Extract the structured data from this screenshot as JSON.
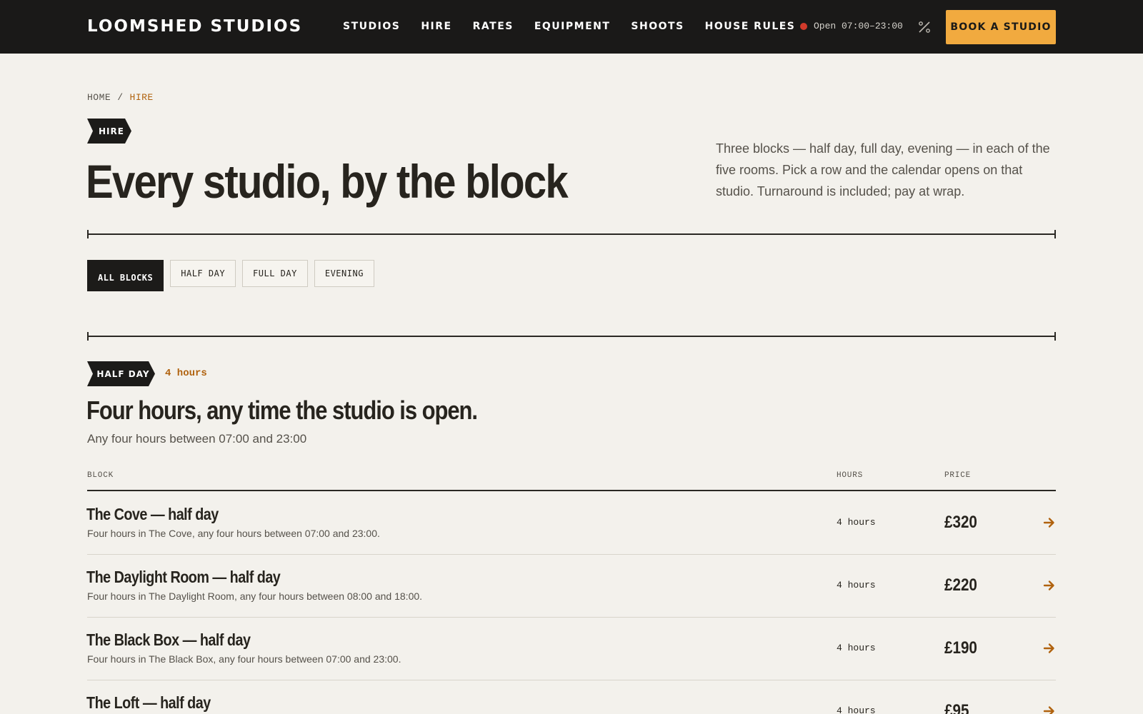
{
  "header": {
    "logo": "LOOMSHED STUDIOS",
    "nav": [
      {
        "label": "STUDIOS"
      },
      {
        "label": "HIRE"
      },
      {
        "label": "RATES"
      },
      {
        "label": "EQUIPMENT"
      },
      {
        "label": "SHOOTS"
      },
      {
        "label": "HOUSE RULES"
      }
    ],
    "status": "Open 07:00–23:00",
    "cta": "BOOK A STUDIO"
  },
  "breadcrumb": {
    "home": "HOME",
    "separator": "/",
    "current": "HIRE"
  },
  "hero": {
    "tag": "HIRE",
    "title": "Every studio, by the block",
    "intro": "Three blocks — half day, full day, evening — in each of the five rooms. Pick a row and the calendar opens on that studio. Turnaround is included; pay at wrap."
  },
  "filters": [
    {
      "label": "ALL BLOCKS",
      "active": true
    },
    {
      "label": "HALF DAY",
      "active": false
    },
    {
      "label": "FULL DAY",
      "active": false
    },
    {
      "label": "EVENING",
      "active": false
    }
  ],
  "section": {
    "tag": "HALF DAY",
    "meta": "4 hours",
    "title": "Four hours, any time the studio is open.",
    "subtitle": "Any four hours between 07:00 and 23:00",
    "columns": {
      "block": "BLOCK",
      "hours": "HOURS",
      "price": "PRICE"
    },
    "rows": [
      {
        "name": "The Cove — half day",
        "desc": "Four hours in The Cove, any four hours between 07:00 and 23:00.",
        "hours": "4 hours",
        "price": "£320"
      },
      {
        "name": "The Daylight Room — half day",
        "desc": "Four hours in The Daylight Room, any four hours between 08:00 and 18:00.",
        "hours": "4 hours",
        "price": "£220"
      },
      {
        "name": "The Black Box — half day",
        "desc": "Four hours in The Black Box, any four hours between 07:00 and 23:00.",
        "hours": "4 hours",
        "price": "£190"
      },
      {
        "name": "The Loft — half day",
        "desc": "",
        "hours": "4 hours",
        "price": "£95"
      }
    ]
  },
  "colors": {
    "accent": "#f1aa3f",
    "accent_text": "#b0620e",
    "dark": "#1a1918",
    "background": "#f3f1ec",
    "status_dot": "#d13a2b"
  },
  "icons": {
    "status": "status-dot",
    "percent": "percent-icon",
    "row_action": "arrow-right-icon"
  }
}
